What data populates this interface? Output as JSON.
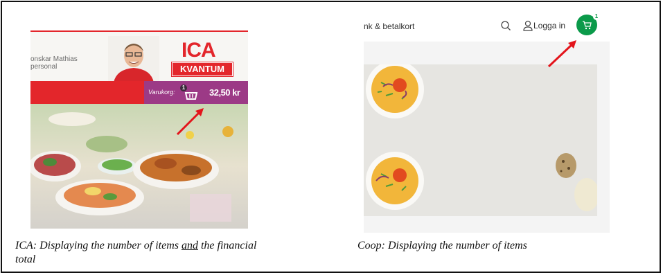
{
  "ica": {
    "header_text_line1": "onskar Mathias",
    "header_text_line2": "personal",
    "logo_text": "ICA",
    "logo_sub": "KVANTUM",
    "cart_label": "Varukorg:",
    "cart_count": "1",
    "cart_total": "32,50 kr",
    "colors": {
      "red": "#e3262b",
      "purple": "#9c3a86"
    }
  },
  "coop": {
    "nav_link": "nk & betalkort",
    "login_label": "Logga in",
    "cart_count": "1",
    "colors": {
      "green": "#0b9a4a"
    }
  },
  "captions": {
    "ica_part1": "ICA: Displaying the number of items ",
    "ica_and": "and",
    "ica_part2": " the financial",
    "ica_line2": "total",
    "coop": "Coop: Displaying the number of items"
  }
}
